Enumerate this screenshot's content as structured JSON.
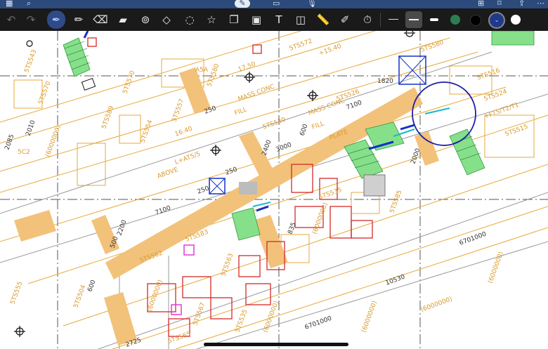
{
  "toolbar": {
    "undo_icon": "undo-icon",
    "redo_icon": "redo-icon",
    "tools": [
      "pen-icon",
      "pencil-icon",
      "eraser-icon",
      "highlighter-icon",
      "lasso-icon",
      "shapes-icon",
      "lasso-select-icon",
      "sticker-icon",
      "copy-icon",
      "image-icon",
      "text-icon",
      "camera-icon",
      "ruler-icon",
      "bluetooth-pen-icon",
      "timer-icon"
    ],
    "stroke_sizes": [
      "thin",
      "medium",
      "thick"
    ],
    "colors": [
      "#2e7d52",
      "#000000",
      "#1f3a8a",
      "#ffffff"
    ],
    "selected_color": "#1f3a8a"
  },
  "drawing": {
    "labels": {
      "l1": "5TS572",
      "l2": "5TS580",
      "l3": "5TS530",
      "l4": "5TS535",
      "l5": "5TS526",
      "l6": "5TS557",
      "l7": "5TS516",
      "l8": "5TS524",
      "l9": "5TS515",
      "l10": "5TS554",
      "l11": "5TS589",
      "l12": "5TS562",
      "l13": "5TS583",
      "l14": "5TS563",
      "l15": "5TS567",
      "l16": "5TS535",
      "l17": "5TS585",
      "l18": "5TS555",
      "l19": "5TS504",
      "l20": "5TS543",
      "l21": "5TS570",
      "l22": "5TS565",
      "l23": "5TS580",
      "l24": "5TS570"
    },
    "dims": {
      "d1": "1820",
      "d2": "7100",
      "d3": "3000",
      "d4": "2400",
      "d5": "7100",
      "d6": "2200",
      "d7": "250",
      "d8": "250",
      "d9": "600",
      "d10": "10530",
      "d11": "6701000",
      "d12": "6701000",
      "d13": "2000",
      "d14": "2010",
      "d15": "835",
      "d16": "250",
      "d17": "500",
      "d18": "600",
      "d19": "2725",
      "d20": "2085"
    },
    "notes": {
      "n1": "MASS CONC",
      "n2": "MASS CONC",
      "n3": "FILL",
      "n4": "FILL",
      "n5": "+15.40",
      "n6": "17.50",
      "n7": "16.40",
      "n8": "ABOVE",
      "n9": "PLATE",
      "n10": "+FT5/T2/T1",
      "n11": "5C2",
      "n12": "A5A",
      "n13": "L+AT5/5",
      "n14": "(6000000)",
      "n15": "(6000000)",
      "n16": "(6000000)",
      "n17": "(6000000)",
      "n18": "(6000000)",
      "n19": "(6000000)",
      "n20": "(6000000)"
    }
  }
}
